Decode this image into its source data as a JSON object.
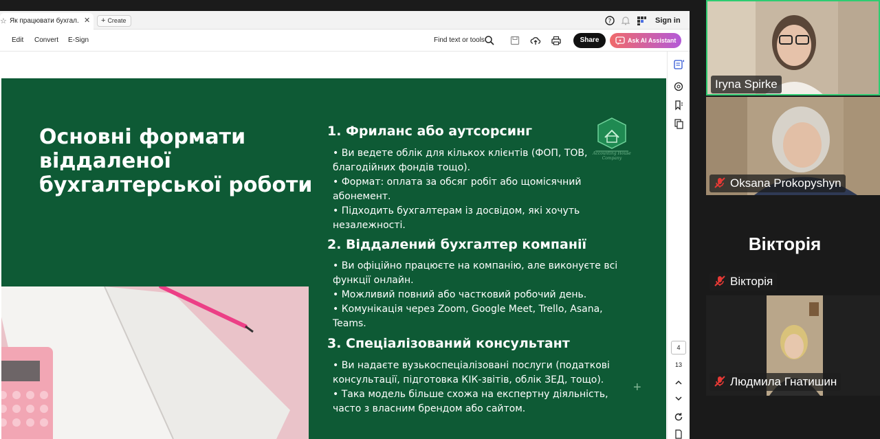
{
  "browser": {
    "tab_title": "Як працювати бухгал...",
    "create_label": "Create",
    "signin_label": "Sign in"
  },
  "toolbar": {
    "menu": [
      "Edit",
      "Convert",
      "E-Sign"
    ],
    "find_label": "Find text or tools",
    "share_label": "Share",
    "ai_label": "Ask AI Assistant"
  },
  "viewer": {
    "current_page": "4",
    "total_pages": "13"
  },
  "slide": {
    "title": "Основні формати віддаленої бухгалтерської роботи",
    "sections": [
      {
        "heading": "1. Фриланс або аутсорсинг",
        "bullets": [
          "• Ви ведете облік для кількох клієнтів (ФОП, ТОВ, благодійних фондів тощо).",
          "• Формат: оплата за обсяг робіт або щомісячний абонемент.",
          "• Підходить бухгалтерам із досвідом, які хочуть незалежності."
        ]
      },
      {
        "heading": "2. Віддалений бухгалтер компанії",
        "bullets": [
          "• Ви офіційно працюєте на компанію, але виконуєте всі функції онлайн.",
          "• Можливий повний або частковий робочий день.",
          "• Комунікація через Zoom, Google Meet, Trello, Asana, Teams."
        ]
      },
      {
        "heading": "3. Спеціалізований консультант",
        "bullets": [
          "• Ви надаєте вузькоспеціалізовані послуги (податкові консультації, підготовка КІК-звітів, облік ЗЕД, тощо).",
          "• Така модель більше схожа на експертну діяльність, часто з власним брендом або сайтом."
        ]
      }
    ],
    "logo_text": "Accounting House Company"
  },
  "participants": [
    {
      "name": "Iryna Spirke",
      "muted": false
    },
    {
      "name": "Oksana Prokopyshyn",
      "muted": true
    },
    {
      "name": "Вікторія",
      "muted": true,
      "avatar_text": "Вікторія"
    },
    {
      "name": "Людмила Гнатишин",
      "muted": true
    }
  ],
  "colors": {
    "slide_green": "#0e5a35",
    "active_speaker_border": "#2ecc71",
    "share_button": "#111111"
  }
}
